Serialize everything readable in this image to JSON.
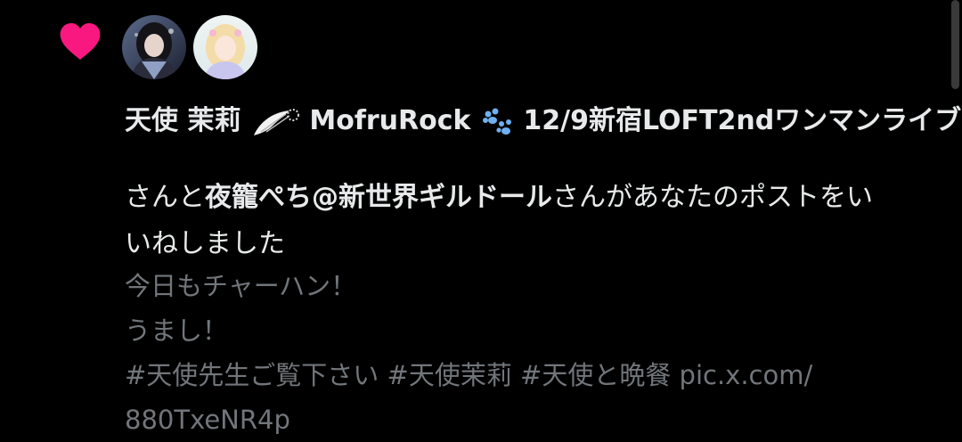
{
  "colors": {
    "background": "#000000",
    "primary_text": "#e7e9ea",
    "secondary_text": "#71767b",
    "heart": "#f91880"
  },
  "icons": {
    "like": "heart-icon",
    "name_emoji_1": "angel-wings-icon",
    "name_emoji_2": "paw-prints-icon"
  },
  "notification": {
    "avatars": [
      {
        "name": "user-avatar-1"
      },
      {
        "name": "user-avatar-2"
      }
    ],
    "name_part_1": "天使 茉莉",
    "name_part_2": "MofruRock",
    "name_part_3": "12/9新宿LOFT2ndワンマンライブ",
    "liked_prefix": "さんと",
    "second_user": "夜籠ぺち@新世界ギルドール",
    "liked_suffix": "さんがあなたのポストをいいねしました",
    "post_text": "今日もチャーハン！\nうまし！\n#天使先生ご覧下さい #天使茉莉 #天使と晩餐 pic.x.com/\n880TxeNR4p"
  }
}
